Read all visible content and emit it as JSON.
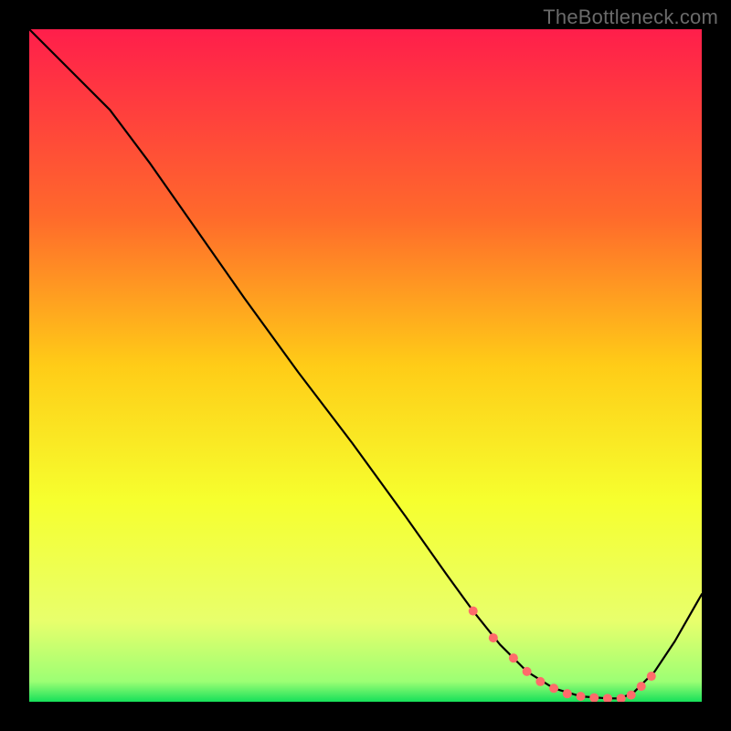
{
  "watermark": "TheBottleneck.com",
  "chart_data": {
    "type": "line",
    "title": "",
    "xlabel": "",
    "ylabel": "",
    "xlim": [
      0,
      100
    ],
    "ylim": [
      0,
      100
    ],
    "grid": false,
    "legend": false,
    "background_gradient": {
      "stops": [
        {
          "pct": 0,
          "color": "#ff1e4b"
        },
        {
          "pct": 28,
          "color": "#ff6a2b"
        },
        {
          "pct": 50,
          "color": "#ffcc17"
        },
        {
          "pct": 70,
          "color": "#f6ff2e"
        },
        {
          "pct": 88,
          "color": "#e8ff6c"
        },
        {
          "pct": 97,
          "color": "#9cff74"
        },
        {
          "pct": 100,
          "color": "#16e05a"
        }
      ]
    },
    "series": [
      {
        "name": "curve",
        "color": "#000000",
        "x": [
          0,
          7,
          12,
          18,
          25,
          32,
          40,
          48,
          56,
          62,
          66,
          70,
          74,
          78,
          82,
          86,
          88,
          90,
          93,
          96,
          100
        ],
        "y": [
          100,
          93,
          88,
          80,
          70,
          60,
          49,
          38.5,
          27.5,
          19,
          13.5,
          8.5,
          4.5,
          2,
          0.8,
          0.5,
          0.5,
          1.5,
          4.5,
          9,
          16
        ]
      }
    ],
    "markers": {
      "name": "trough-dots",
      "color": "#ff6b6b",
      "radius": 5,
      "x": [
        66,
        69,
        72,
        74,
        76,
        78,
        80,
        82,
        84,
        86,
        88,
        89.5,
        91,
        92.5
      ],
      "y": [
        13.5,
        9.5,
        6.5,
        4.5,
        3.0,
        2.0,
        1.2,
        0.8,
        0.6,
        0.5,
        0.5,
        1.0,
        2.3,
        3.8
      ]
    }
  }
}
